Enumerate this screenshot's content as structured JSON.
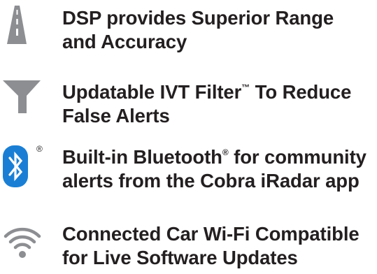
{
  "features": [
    {
      "icon": "road-icon",
      "line1": "DSP provides Superior Range",
      "line2": "and Accuracy"
    },
    {
      "icon": "filter-icon",
      "line1_pre": "Updatable IVT Filter",
      "line1_mark": "™",
      "line1_post": " To Reduce",
      "line2": "False Alerts"
    },
    {
      "icon": "bluetooth-icon",
      "icon_mark": "®",
      "line1_pre": "Built-in Bluetooth",
      "line1_mark": "®",
      "line1_post": " for community",
      "line2": "alerts from the Cobra iRadar app"
    },
    {
      "icon": "wifi-icon",
      "line1": "Connected Car Wi-Fi Compatible",
      "line2": "for Live Software Updates"
    }
  ],
  "colors": {
    "text": "#231f20",
    "icon_gray": "#8c8e91",
    "bluetooth_blue": "#1a7fd4"
  }
}
